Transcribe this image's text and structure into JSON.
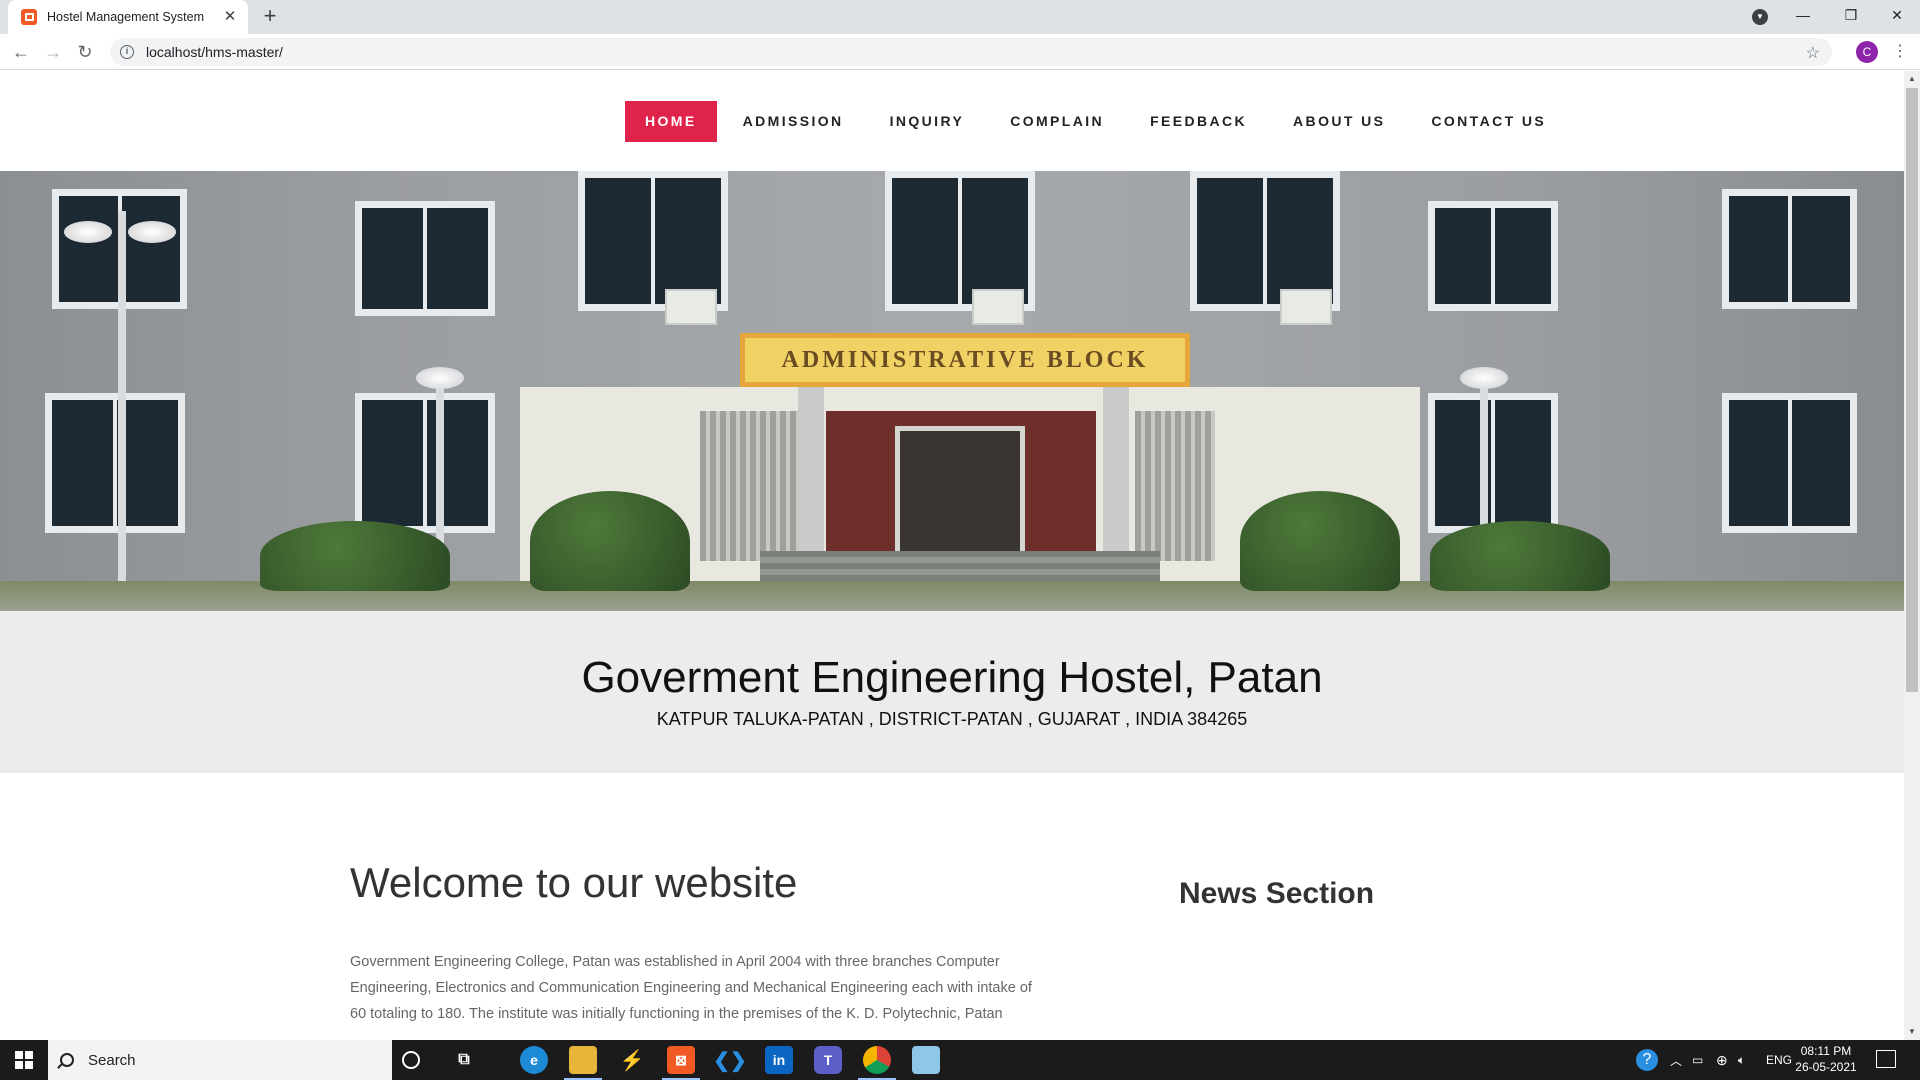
{
  "browser": {
    "tab_title": "Hostel Management System",
    "tab_close": "✕",
    "new_tab": "+",
    "url": "localhost/hms-master/",
    "profile_initial": "C"
  },
  "nav": {
    "items": [
      {
        "label": "HOME",
        "active": true
      },
      {
        "label": "ADMISSION",
        "active": false
      },
      {
        "label": "INQUIRY",
        "active": false
      },
      {
        "label": "COMPLAIN",
        "active": false
      },
      {
        "label": "FEEDBACK",
        "active": false
      },
      {
        "label": "ABOUT US",
        "active": false
      },
      {
        "label": "CONTACT US",
        "active": false
      }
    ],
    "active_color": "#e0234a"
  },
  "hero": {
    "sign_text": "ADMINISTRATIVE  BLOCK"
  },
  "header": {
    "title": "Goverment Engineering Hostel, Patan",
    "address": "KATPUR TALUKA-PATAN , DISTRICT-PATAN , GUJARAT , INDIA 384265"
  },
  "main": {
    "welcome_heading": "Welcome to our website",
    "news_heading": "News Section",
    "intro_lines": [
      "Government Engineering College, Patan was established in April 2004 with three branches Computer",
      "Engineering, Electronics and Communication Engineering and Mechanical Engineering each with intake of",
      "60 totaling to 180. The institute was initially functioning in the premises of the K. D. Polytechnic, Patan"
    ]
  },
  "taskbar": {
    "search_placeholder": "Search",
    "language": "ENG",
    "time": "08:11 PM",
    "date": "26-05-2021"
  }
}
